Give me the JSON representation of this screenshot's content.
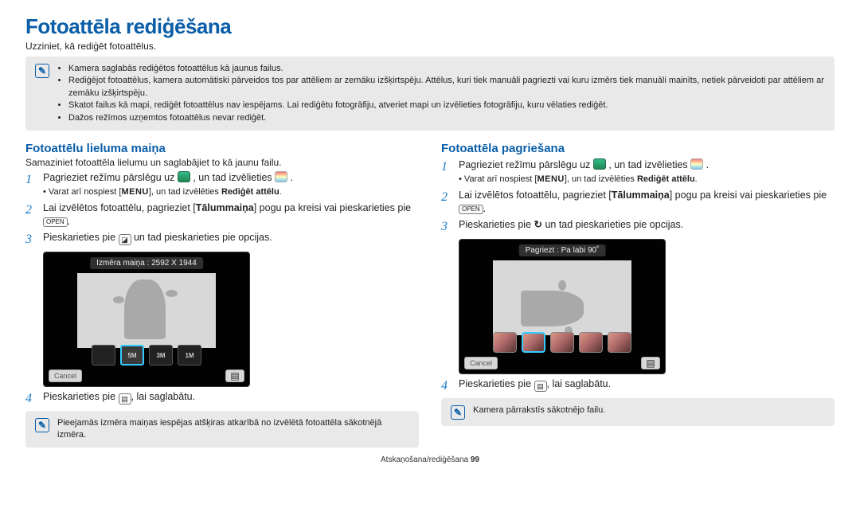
{
  "title": "Fotoattēla rediģēšana",
  "intro": "Uzziniet, kā rediģēt fotoattēlus.",
  "top_note": {
    "items": [
      "Kamera saglabās rediģētos fotoattēlus kā jaunus failus.",
      "Rediģējot fotoattēlus, kamera automātiski pārveidos tos par attēliem ar zemāku izšķirtspēju. Attēlus, kuri tiek manuāli pagriezti vai kuru izmērs tiek manuāli mainīts, netiek pārveidoti par attēliem ar zemāku izšķirtspēju.",
      "Skatot failus kā mapi, rediģēt fotoattēlus nav iespējams. Lai rediģētu fotogrāfiju, atveriet mapi un izvēlieties fotogrāfiju, kuru vēlaties rediģēt.",
      "Dažos režīmos uzņemtos fotoattēlus nevar rediģēt."
    ]
  },
  "left": {
    "heading": "Fotoattēlu lieluma maiņa",
    "sub": "Samaziniet fotoattēla lielumu un saglabājiet to kā jaunu failu.",
    "steps": {
      "s1_a": "Pagrieziet režīmu pārslēgu uz ",
      "s1_b": ", un tad izvēlieties ",
      "s1_c": ".",
      "s1_sub_a": "Varat arī nospiest [",
      "s1_sub_b": "], un tad izvēlēties ",
      "s1_sub_c": "Rediģēt attēlu",
      "s2_a": "Lai izvēlētos fotoattēlu, pagrieziet [",
      "s2_b": "Tālummaiņa",
      "s2_c": "] pogu pa kreisi vai pieskarieties pie ",
      "s2_d": ".",
      "s3_a": "Pieskarieties pie ",
      "s3_b": " un tad pieskarieties pie opcijas.",
      "s4_a": "Pieskarieties pie ",
      "s4_b": ", lai saglabātu."
    },
    "preview": {
      "label": "Izmēra maiņa : 2592 X 1944",
      "thumbs": [
        "",
        "5M",
        "3M",
        "1M"
      ],
      "cancel": "Cancel"
    },
    "bottom_note": "Pieejamās izmēra maiņas iespējas atšķiras atkarībā no izvēlētā fotoattēla sākotnējā izmēra."
  },
  "right": {
    "heading": "Fotoattēla pagriešana",
    "steps": {
      "s1_a": "Pagrieziet režīmu pārslēgu uz ",
      "s1_b": ", un tad izvēlieties ",
      "s1_c": ".",
      "s1_sub_a": "Varat arī nospiest [",
      "s1_sub_b": "], un tad izvēlēties ",
      "s1_sub_c": "Rediģēt attēlu",
      "s2_a": "Lai izvēlētos fotoattēlu, pagrieziet [",
      "s2_b": "Tālummaiņa",
      "s2_c": "] pogu pa kreisi vai pieskarieties pie ",
      "s2_d": ".",
      "s3_a": "Pieskarieties pie ",
      "s3_b": " un tad pieskarieties pie opcijas.",
      "s4_a": "Pieskarieties pie ",
      "s4_b": ", lai saglabātu."
    },
    "preview": {
      "label": "Pagriezt : Pa labi 90˚",
      "cancel": "Cancel"
    },
    "bottom_note": "Kamera pārrakstīs sākotnējo failu."
  },
  "menu_label": "MENU",
  "open_label": "OPEN",
  "footer_a": "Atskaņošana/rediģēšana  ",
  "footer_b": "99"
}
